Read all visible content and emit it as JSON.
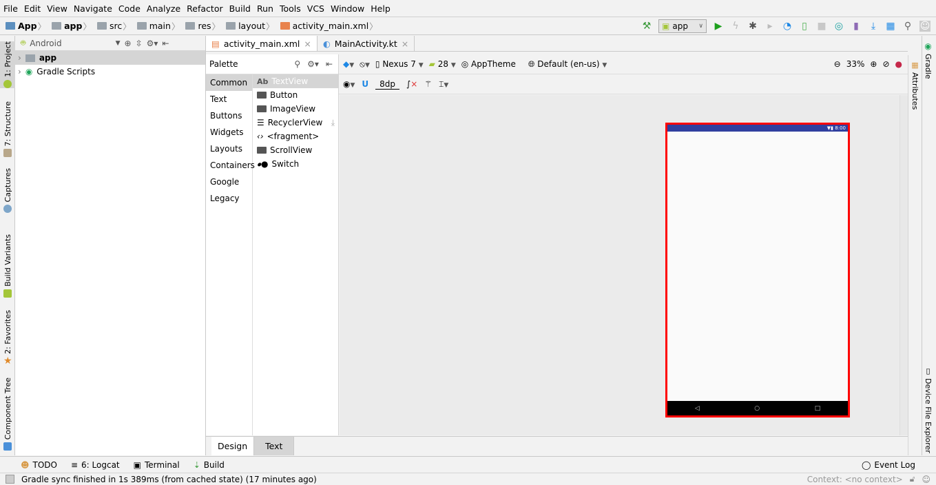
{
  "menu": [
    "File",
    "Edit",
    "View",
    "Navigate",
    "Code",
    "Analyze",
    "Refactor",
    "Build",
    "Run",
    "Tools",
    "VCS",
    "Window",
    "Help"
  ],
  "breadcrumb": [
    "App",
    "app",
    "src",
    "main",
    "res",
    "layout",
    "activity_main.xml"
  ],
  "run_config": "app",
  "left_stripe": [
    "1: Project",
    "7: Structure",
    "Captures",
    "Build Variants",
    "2: Favorites",
    "Component Tree"
  ],
  "right_stripe": [
    "Gradle",
    "Attributes",
    "Device File Explorer"
  ],
  "project": {
    "view": "Android",
    "tree": [
      "app",
      "Gradle Scripts"
    ]
  },
  "editor_tabs": [
    "activity_main.xml",
    "MainActivity.kt"
  ],
  "palette": {
    "title": "Palette",
    "categories": [
      "Common",
      "Text",
      "Buttons",
      "Widgets",
      "Layouts",
      "Containers",
      "Google",
      "Legacy"
    ],
    "items": [
      "TextView",
      "Button",
      "ImageView",
      "RecyclerView",
      "<fragment>",
      "ScrollView",
      "Switch"
    ],
    "textview_prefix": "Ab"
  },
  "toolbar": {
    "device": "Nexus 7",
    "api": "28",
    "theme": "AppTheme",
    "locale": "Default (en-us)",
    "zoom": "33%",
    "margin": "8dp"
  },
  "phone": {
    "time": "8:00",
    "status_color": "#303f9f"
  },
  "design_tabs": [
    "Design",
    "Text"
  ],
  "tool_windows": [
    "TODO",
    "6: Logcat",
    "Terminal",
    "Build"
  ],
  "event_log": "Event Log",
  "status": {
    "message": "Gradle sync finished in 1s 389ms (from cached state) (17 minutes ago)",
    "context": "Context: <no context>"
  }
}
